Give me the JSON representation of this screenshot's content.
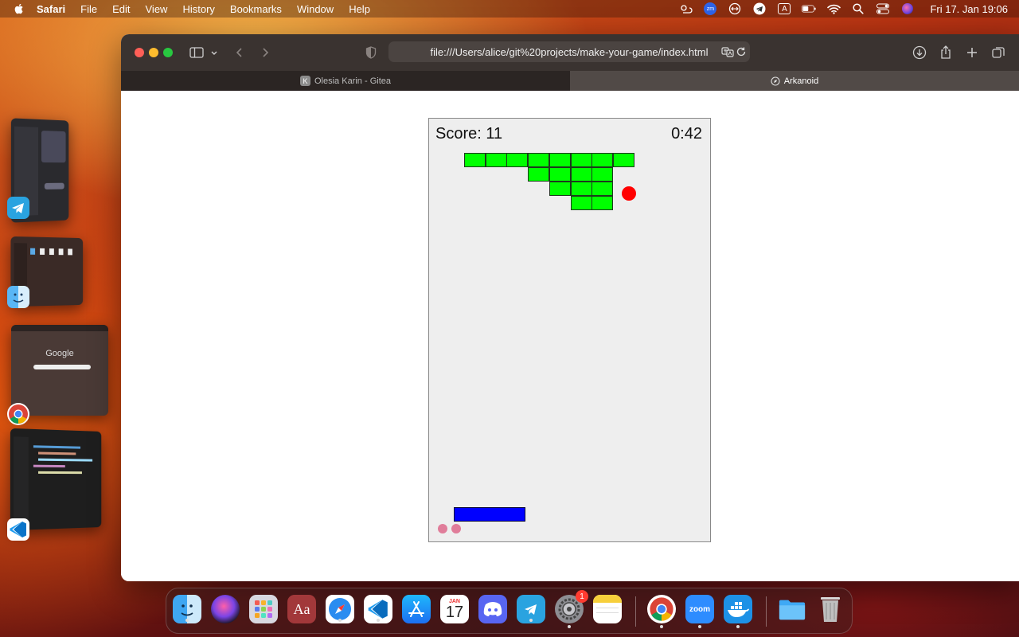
{
  "menubar": {
    "app_name": "Safari",
    "items": [
      "File",
      "Edit",
      "View",
      "History",
      "Bookmarks",
      "Window",
      "Help"
    ],
    "clock": "Fri 17. Jan  19:06",
    "zoom_label": "zm",
    "input_label": "A"
  },
  "browser": {
    "url": "file:///Users/alice/git%20projects/make-your-game/index.html",
    "tabs": [
      {
        "label": "Olesia Karin - Gitea",
        "favicon": "K"
      },
      {
        "label": "Arkanoid"
      }
    ]
  },
  "game": {
    "score_label": "Score: 11",
    "timer": "0:42",
    "lives_remaining": 2
  },
  "stage_manager": {
    "google_label": "Google"
  },
  "dock": {
    "calendar_month": "JAN",
    "calendar_day": "17",
    "dictionary_label": "Aa",
    "zoom_label": "zoom",
    "settings_badge": "1"
  },
  "colors": {
    "brick": "#00ff00",
    "ball": "#ff0000",
    "paddle": "#0000ff",
    "life": "#e07d9a"
  }
}
